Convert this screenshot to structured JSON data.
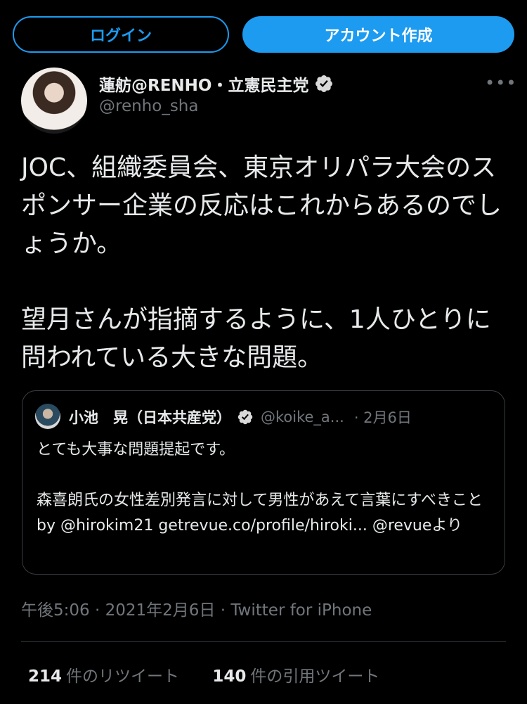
{
  "header": {
    "login_label": "ログイン",
    "signup_label": "アカウント作成",
    "accent_color": "#1d9bf0"
  },
  "tweet": {
    "author_name": "蓮舫@RENHO・立憲民主党",
    "author_handle": "@renho_sha",
    "more_label": "•••",
    "text_para1": "JOC、組織委員会、東京オリパラ大会のスポンサー企業の反応はこれからあるのでしょうか。",
    "text_para2": "望月さんが指摘するように、1人ひとりに問われている大きな問題。",
    "timestamp": "午後5:06 · 2021年2月6日 · Twitter for iPhone"
  },
  "quote": {
    "author_name": "小池　晃（日本共産党）",
    "author_handle": "@koike_a...",
    "date": "· 2月6日",
    "text_line1": "とても大事な問題提起です。",
    "text_line2": "森喜朗氏の女性差別発言に対して男性があえて言葉にすべきこと by @hirokim21 getrevue.co/profile/hiroki... @revueより"
  },
  "stats": {
    "retweets_count": "214",
    "retweets_label": "件のリツイート",
    "quotes_count": "140",
    "quotes_label": "件の引用ツイート"
  },
  "icons": {
    "verified": "verified-badge-icon",
    "more": "more-dots-icon"
  }
}
